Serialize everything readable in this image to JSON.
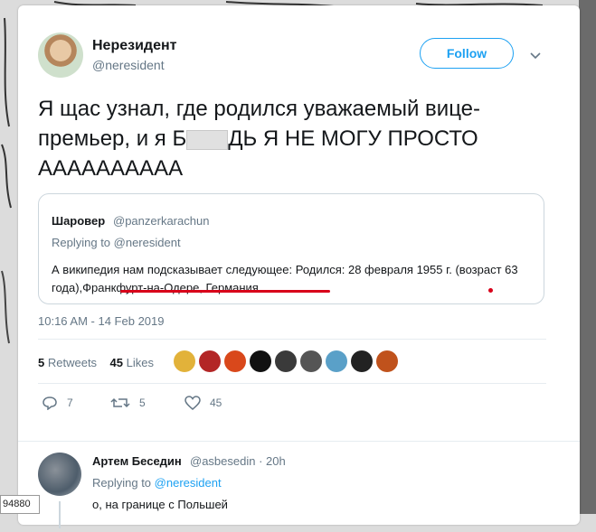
{
  "tweet": {
    "author_name": "Нерезидент",
    "author_handle": "@neresident",
    "follow_label": "Follow",
    "text_before_censor": "Я щас узнал, где родился уважаемый вице-премьер, и я Б",
    "text_after_censor": "ДЬ Я НЕ МОГУ ПРОСТО АААААААААА",
    "timestamp": "10:16 AM - 14 Feb 2019"
  },
  "quote": {
    "name": "Шаровер",
    "handle": "@panzerkarachun",
    "replying_to": "Replying to @neresident",
    "text": "А википедия нам подсказывает следующее: Родился: 28 февраля 1955 г. (возраст 63 года),Франкфурт-на-Одере, Германия"
  },
  "stats": {
    "retweets_count": "5",
    "retweets_label": "Retweets",
    "likes_count": "45",
    "likes_label": "Likes"
  },
  "actions": {
    "reply_count": "7",
    "retweet_count": "5",
    "like_count": "45"
  },
  "reply": {
    "name": "Артем Беседин",
    "handle_time": "@asbesedin · 20h",
    "replying_prefix": "Replying to ",
    "replying_handle": "@neresident",
    "text": "о, на границе с Польшей"
  },
  "counter": "94880",
  "colors": {
    "accent": "#1da1f2",
    "annotation_red": "#d8001a",
    "muted_text": "#657786"
  }
}
